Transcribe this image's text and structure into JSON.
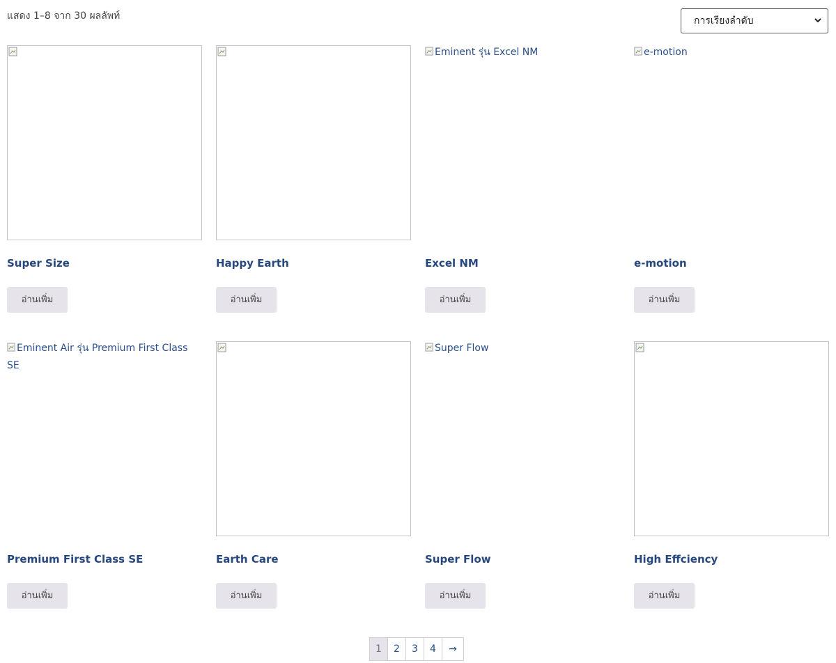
{
  "result_count": "แสดง 1–8 จาก 30 ผลลัพท์",
  "ordering": {
    "selected": "การเรียงลำดับ"
  },
  "products": [
    {
      "title": "Super Size",
      "image_alt": "",
      "button": "อ่านเพิ่ม"
    },
    {
      "title": "Happy Earth",
      "image_alt": "",
      "button": "อ่านเพิ่ม"
    },
    {
      "title": "Excel NM",
      "image_alt": "Eminent รุ่น Excel NM",
      "button": "อ่านเพิ่ม"
    },
    {
      "title": "e-motion",
      "image_alt": "e-motion",
      "button": "อ่านเพิ่ม"
    },
    {
      "title": "Premium First Class SE",
      "image_alt": "Eminent Air รุ่น Premium First Class SE",
      "button": "อ่านเพิ่ม"
    },
    {
      "title": "Earth Care",
      "image_alt": "",
      "button": "อ่านเพิ่ม"
    },
    {
      "title": "Super Flow",
      "image_alt": "Super Flow",
      "button": "อ่านเพิ่ม"
    },
    {
      "title": "High Effciency",
      "image_alt": "",
      "button": "อ่านเพิ่ม"
    }
  ],
  "pagination": {
    "pages": [
      "1",
      "2",
      "3",
      "4"
    ],
    "current": "1",
    "next": "→"
  },
  "colors": {
    "link": "#27487f",
    "button_bg": "#e6e4ea"
  }
}
